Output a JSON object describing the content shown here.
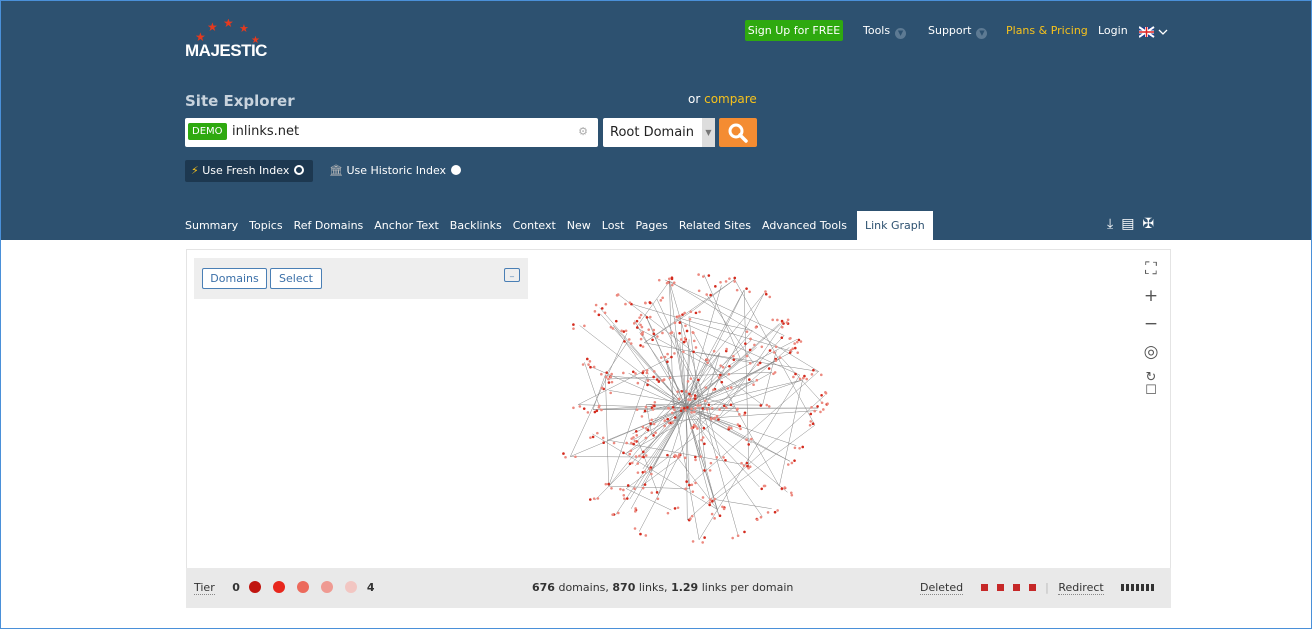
{
  "header": {
    "logo": "MAJESTIC",
    "signup": "Sign Up for FREE",
    "nav": [
      "Tools",
      "Support"
    ],
    "plans": "Plans & Pricing",
    "login": "Login",
    "language_icon": "uk-flag-icon"
  },
  "search": {
    "title": "Site Explorer",
    "compare_prefix": "or",
    "compare_link": "compare",
    "badge": "DEMO",
    "value": "inlinks.net",
    "scope": "Root Domain",
    "fresh_index": "Use Fresh Index",
    "historic_index": "Use Historic Index",
    "fresh_selected": true
  },
  "tabs": [
    "Summary",
    "Topics",
    "Ref Domains",
    "Anchor Text",
    "Backlinks",
    "Context",
    "New",
    "Lost",
    "Pages",
    "Related Sites",
    "Advanced Tools",
    "Link Graph"
  ],
  "active_tab": "Link Graph",
  "graph": {
    "buttons": {
      "domains": "Domains",
      "select": "Select"
    },
    "minimize": "_"
  },
  "footer": {
    "tier_label": "Tier",
    "tier_min": "0",
    "tier_max": "4",
    "tier_colors": [
      "#c0150f",
      "#e8271d",
      "#ec6a5c",
      "#ef9a92",
      "#f2c6c2"
    ],
    "domains": "676",
    "domains_label": "domains,",
    "links": "870",
    "links_label": "links,",
    "per_domain": "1.29",
    "per_domain_label": "links per domain",
    "deleted": "Deleted",
    "redirect": "Redirect"
  },
  "colors": {
    "header": "#2d5170",
    "accent": "#f7c21c",
    "signup": "#2ea90f",
    "search_button": "#f48c32"
  }
}
